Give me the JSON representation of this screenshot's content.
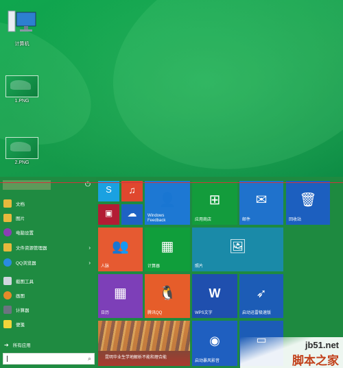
{
  "desktop": {
    "icons": [
      {
        "label": "计算机",
        "icon": "computer-icon"
      },
      {
        "label": "1.PNG",
        "icon": "image-file-icon"
      },
      {
        "label": "2.PNG",
        "icon": "image-file-icon"
      }
    ]
  },
  "start_menu": {
    "power_icon": "⏻",
    "items": [
      {
        "label": "文档",
        "icon": "documents-icon",
        "color": "#e7b93d"
      },
      {
        "label": "图片",
        "icon": "pictures-icon",
        "color": "#e7b93d"
      },
      {
        "label": "电脑设置",
        "icon": "settings-icon",
        "color": "#8a3fb5"
      },
      {
        "label": "文件资源管理器",
        "icon": "file-explorer-icon",
        "color": "#e7b93d",
        "arrow": "›"
      },
      {
        "label": "QQ浏览器",
        "icon": "qq-browser-icon",
        "color": "#2a8be0",
        "arrow": "›"
      },
      {
        "label": "截图工具",
        "icon": "snipping-tool-icon",
        "color": "#d0d6de"
      },
      {
        "label": "画图",
        "icon": "paint-icon",
        "color": "#e58a2a"
      },
      {
        "label": "计算器",
        "icon": "calculator-icon",
        "color": "#6b7480"
      },
      {
        "label": "便笺",
        "icon": "sticky-notes-icon",
        "color": "#f2d43a"
      }
    ],
    "all_apps": "所有应用",
    "all_apps_arrow": "➔",
    "search_icon": "⌕"
  },
  "tiles": {
    "windows_feedback": "Windows\nFeedback",
    "store": "应用商店",
    "mail": "邮件",
    "recycle_bin": "回收站",
    "people": "人脉",
    "calculator": "计算器",
    "photos": "照片",
    "calendar": "日历",
    "tencent_qq": "腾讯QQ",
    "wps": "WPS文字",
    "launcher": "启动迅雷极速版",
    "news": "昆明华业生学地解析不能和理合能",
    "baofeng": "启动暴风影音",
    "colors": {
      "skype": "#1aa1e1",
      "music": "#e0472e",
      "video": "#b31c34",
      "onedrive": "#1f62c4",
      "windows_feedback": "#1d78d3",
      "store": "#139c3c",
      "mail": "#1f72cc",
      "recycle_bin": "#1c5fbf",
      "people": "#e65a31",
      "calculator": "#109e3b",
      "photos": "#1a8aa8",
      "calendar": "#7d3fb8",
      "tencent_qq": "#e65d2a",
      "wps": "#1f4fae",
      "launcher": "#1c5cb6",
      "news": "#a93a2e",
      "baofeng": "#1f5fc0",
      "extra": "#1c5cb6"
    }
  },
  "watermark": {
    "site": "jb51.net",
    "brand": "脚本之家"
  }
}
